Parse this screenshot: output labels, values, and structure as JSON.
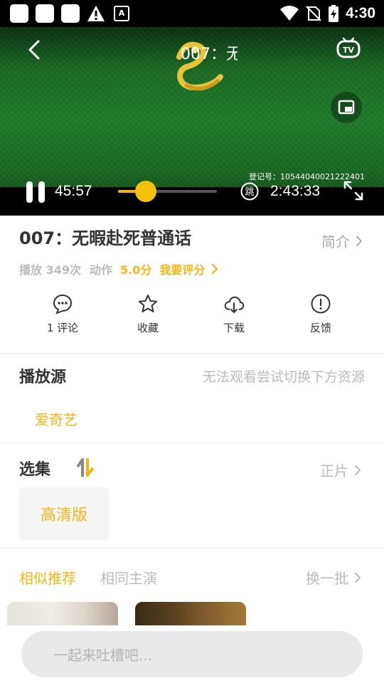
{
  "status_bar": {
    "time": "4:30",
    "left_icons": [
      "app-notification-icon",
      "app-notification-icon",
      "app-notification-icon",
      "warning-icon",
      "a-badge-icon"
    ],
    "a_badge_text": "A",
    "right_icons": [
      "wifi-icon",
      "no-sim-icon",
      "battery-charging-icon"
    ]
  },
  "player": {
    "title": "007：无",
    "registration": "登记号：10544040021222401",
    "current_time": "45:57",
    "total_time": "2:43:33",
    "progress_fraction": 0.28,
    "skip_label": "跳",
    "colors": {
      "accent": "#f4b800"
    }
  },
  "movie": {
    "title": "007：无暇赴死普通话",
    "intro_label": "简介",
    "plays": "播放 349次",
    "genre": "动作",
    "score": "5.0分",
    "rate_label": "我要评分"
  },
  "actions": [
    {
      "icon": "comment-icon",
      "label": "1 评论"
    },
    {
      "icon": "star-icon",
      "label": "收藏"
    },
    {
      "icon": "cloud-download-icon",
      "label": "下载"
    },
    {
      "icon": "feedback-icon",
      "label": "反馈"
    }
  ],
  "sources": {
    "title": "播放源",
    "hint": "无法观看尝试切换下方资源",
    "items": [
      "爱奇艺"
    ]
  },
  "episodes": {
    "title": "选集",
    "feature_link": "正片",
    "items": [
      "高清版"
    ]
  },
  "recommend": {
    "tabs": [
      "相似推荐",
      "相同主演"
    ],
    "active_tab": 0,
    "refresh_label": "换一批"
  },
  "comment_input": {
    "placeholder": "一起来吐槽吧..."
  }
}
